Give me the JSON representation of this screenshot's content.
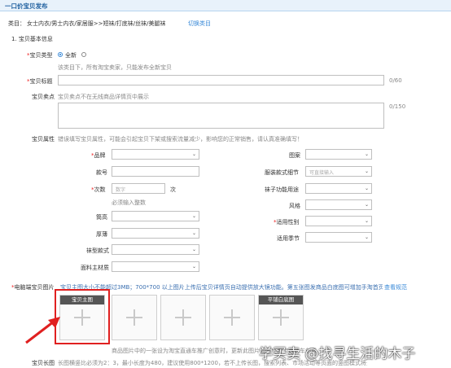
{
  "header": {
    "title": "一口价宝贝发布"
  },
  "category": {
    "label": "类目：",
    "path": "女士内衣/男士内衣/家居服>>短袜/打底袜/丝袜/美腿袜",
    "switch_link": "切换类目"
  },
  "section1": {
    "title": "1. 宝贝基本信息"
  },
  "item_type": {
    "label": "宝贝类型",
    "opt_new": "全新",
    "opt_used": "",
    "hint": "该类目下，所有淘宝卖家，只能发布全新宝贝"
  },
  "item_title": {
    "label": "宝贝标题",
    "counter": "0/60"
  },
  "selling_point": {
    "label": "宝贝卖点",
    "placeholder": "宝贝卖点不在无线商品详情页中展示",
    "counter": "0/150"
  },
  "attributes": {
    "label": "宝贝属性",
    "hint": "错误填写宝贝属性，可能会引起宝贝下架或搜索流量减少，影响您的正常销售，请认真准确填写！",
    "left": {
      "brand": "品牌",
      "model": "款号",
      "denier": "次数",
      "denier_placeholder": "数字",
      "denier_unit": "次",
      "denier_hint": "必须输入整数",
      "tube_height": "筒高",
      "thickness": "厚薄",
      "style": "袜型款式",
      "material": "面料主材质"
    },
    "right": {
      "pattern": "图案",
      "detail": "服装款式细节",
      "detail_placeholder": "可直接输入",
      "function": "袜子功能用途",
      "fashion_style": "风格",
      "gender": "适用性别",
      "season": "适用季节"
    }
  },
  "pc_images": {
    "label": "电脑端宝贝图片",
    "hint": "宝贝主图大小不能超过3MB；700*700 以上图片上传后宝贝详情页自动提供放大镜功能。第五张图发商品白底图可增加手淘首页曝光机会",
    "view_link": "查看规范",
    "main_caption": "宝贝主图",
    "white_caption": "平铺白底图",
    "note": "商品图片中的一张设为淘宝直通车推广创意时，更新此图片会同步淘宝直通车创意。"
  },
  "long_image": {
    "label": "宝贝长图",
    "hint": "长图横竖比必须为2：3，最小长度为480，建议使用800*1200，若不上传长图，搜索列表、市场活动等页面的竖图模式将无法展示宝贝"
  },
  "watermark": {
    "text": "学买卖 @找寻生活的木子"
  },
  "icons": {
    "dropdown": "chevron-down-icon",
    "add": "plus-icon",
    "annotation": "red-arrow"
  }
}
